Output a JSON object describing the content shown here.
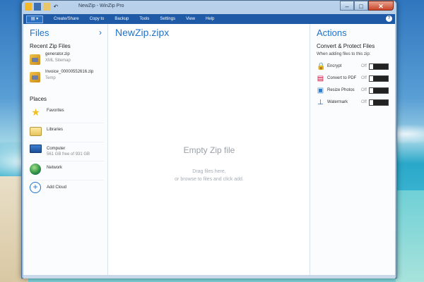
{
  "window": {
    "title": "NewZip - WinZip Pro",
    "controls": {
      "minimize": "–",
      "maximize": "□",
      "close": "✕"
    }
  },
  "menubar": {
    "file_label": "▤ ▾",
    "items": [
      "Create/Share",
      "Copy to",
      "Backup",
      "Tools",
      "Settings",
      "View",
      "Help"
    ],
    "help_icon": "?"
  },
  "files_pane": {
    "heading": "Files",
    "chevron": "›",
    "recent_heading": "Recent Zip Files",
    "recent": [
      {
        "name": "generator.zip",
        "sub": "XML Sitemap"
      },
      {
        "name": "Invoice_00000552616.zip",
        "sub": "Temp"
      }
    ],
    "places_heading": "Places",
    "places": [
      {
        "name": "Favorites",
        "sub": ""
      },
      {
        "name": "Libraries",
        "sub": ""
      },
      {
        "name": "Computer",
        "sub": "561 GB free of 931 GB"
      },
      {
        "name": "Network",
        "sub": ""
      },
      {
        "name": "Add Cloud",
        "sub": ""
      }
    ]
  },
  "center_pane": {
    "zip_name": "NewZip.zipx",
    "empty_title": "Empty Zip file",
    "empty_line1": "Drag files here,",
    "empty_line2": "or browse to files and click add."
  },
  "actions_pane": {
    "heading": "Actions",
    "subheading": "Convert & Protect Files",
    "note": "When adding files to this zip:",
    "items": [
      {
        "label": "Encrypt",
        "state": "Off",
        "icon": "lock-icon"
      },
      {
        "label": "Convert to PDF",
        "state": "Off",
        "icon": "pdf-icon"
      },
      {
        "label": "Resize Photos",
        "state": "Off",
        "icon": "photo-icon"
      },
      {
        "label": "Watermark",
        "state": "Off",
        "icon": "stamp-icon"
      }
    ]
  },
  "colors": {
    "accent": "#1f73c8",
    "menubar": "#1e5aa6"
  }
}
